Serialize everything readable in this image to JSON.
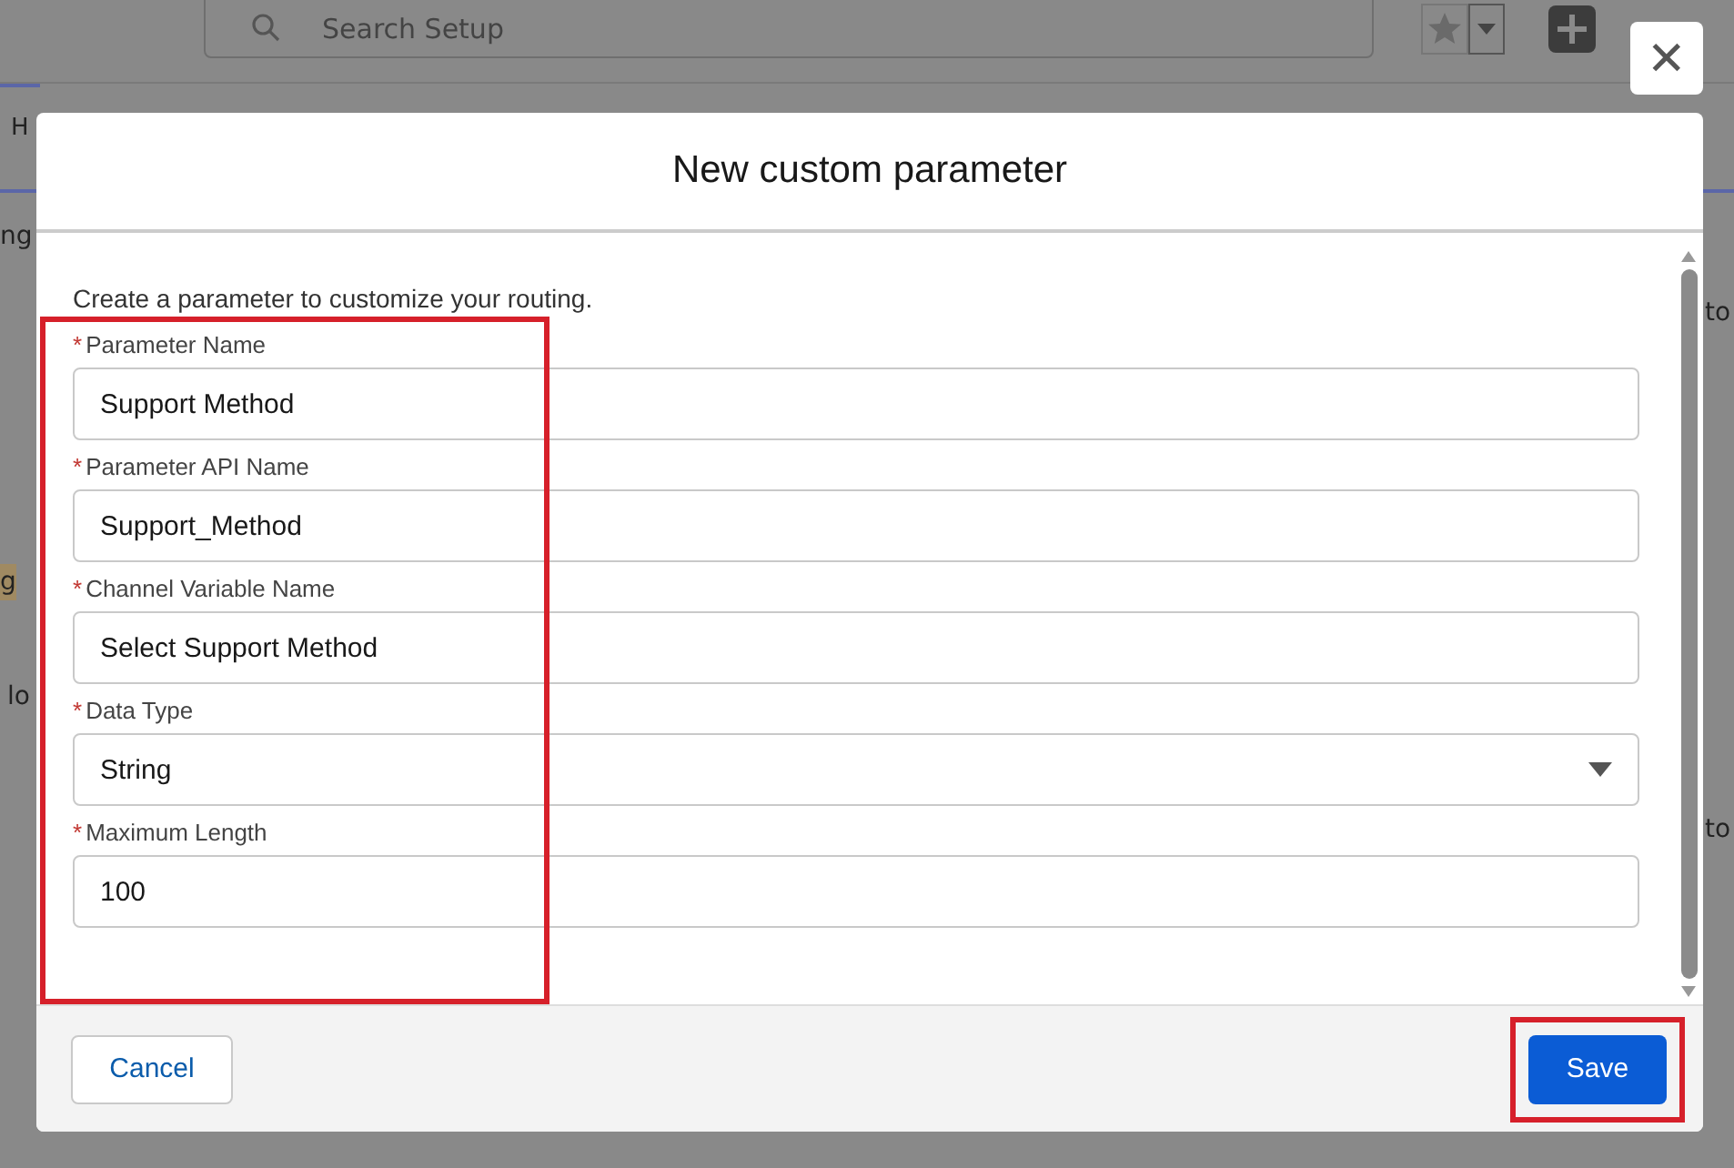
{
  "background": {
    "search": {
      "placeholder": "Search Setup"
    },
    "tab_label": "H",
    "side_fragments": [
      "ng",
      "g",
      "lo"
    ],
    "right_fragments": [
      "to",
      "to"
    ]
  },
  "modal": {
    "title": "New custom parameter",
    "intro": "Create a parameter to customize your routing.",
    "fields": [
      {
        "label": "Parameter Name",
        "required": true,
        "kind": "text",
        "value": "Support Method"
      },
      {
        "label": "Parameter API Name",
        "required": true,
        "kind": "text",
        "value": "Support_Method"
      },
      {
        "label": "Channel Variable Name",
        "required": true,
        "kind": "text",
        "value": "Select Support Method"
      },
      {
        "label": "Data Type",
        "required": true,
        "kind": "select",
        "value": "String"
      },
      {
        "label": "Maximum Length",
        "required": true,
        "kind": "text",
        "value": "100"
      }
    ],
    "required_mark": "*",
    "close": "✕",
    "cancel": "Cancel",
    "save": "Save"
  }
}
